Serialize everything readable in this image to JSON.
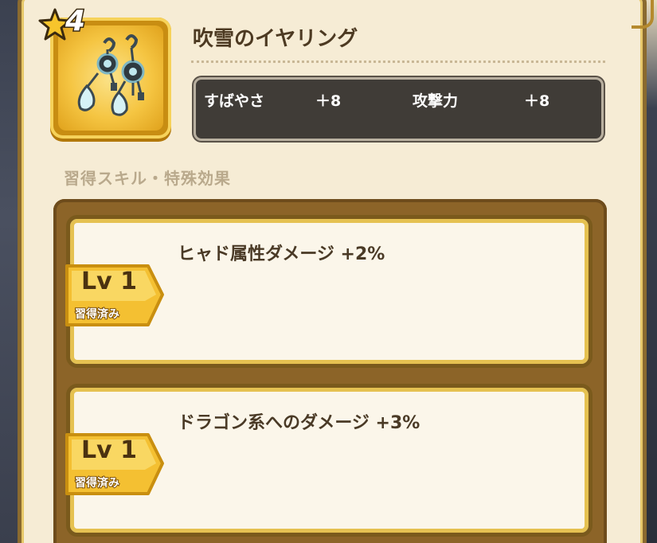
{
  "item": {
    "rarity": "4",
    "name": "吹雪のイヤリング",
    "icon": "frost-earrings-icon"
  },
  "stats": [
    {
      "label": "すばやさ",
      "value": "＋8"
    },
    {
      "label": "攻撃力",
      "value": "＋8"
    }
  ],
  "section_title": "習得スキル・特殊効果",
  "skills": [
    {
      "level": "Lv 1",
      "status": "習得済み",
      "effect": "ヒャド属性ダメージ +2%"
    },
    {
      "level": "Lv 1",
      "status": "習得済み",
      "effect": "ドラゴン系へのダメージ +3%"
    }
  ],
  "colors": {
    "panel_bg": "#f6ecd5",
    "stat_box_bg": "#403c37",
    "gold": "#f5c542",
    "skill_area": "#8c6428"
  }
}
